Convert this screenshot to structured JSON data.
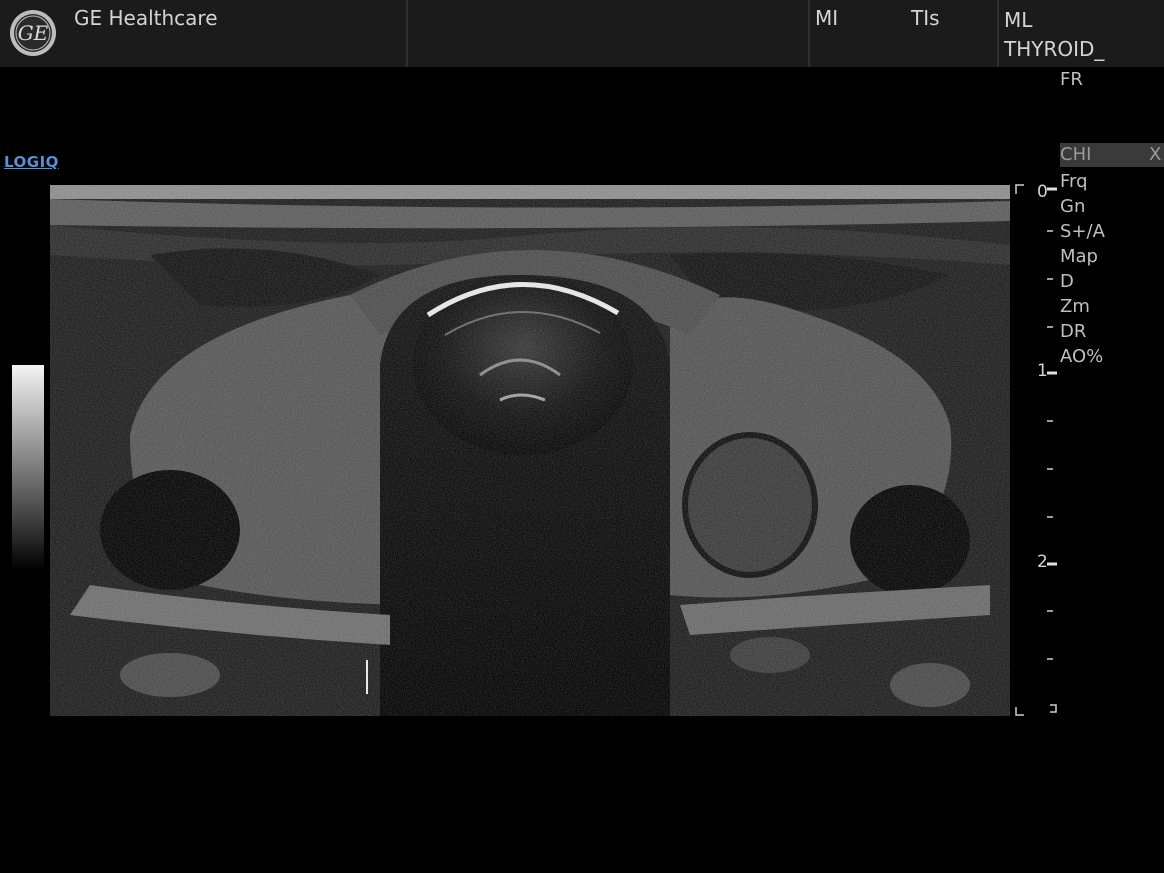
{
  "header": {
    "brand": "GE Healthcare",
    "logo_text": "GE",
    "mi_label": "MI",
    "tis_label": "TIs",
    "ml_label": "ML",
    "preset": "THYROID_"
  },
  "panel": {
    "fr_label": "FR",
    "chi_label": "CHI",
    "chi_close": "X",
    "params": [
      "Frq",
      "Gn",
      "S+/A",
      "Map",
      "D",
      "Zm",
      "DR",
      "AO%"
    ]
  },
  "logiq_link": "LOGIQ",
  "depth_scale": {
    "labels": [
      "0",
      "1",
      "2"
    ]
  },
  "icons": {
    "logo": "ge-logo-icon",
    "grayscale": "grayscale-bar-icon"
  }
}
